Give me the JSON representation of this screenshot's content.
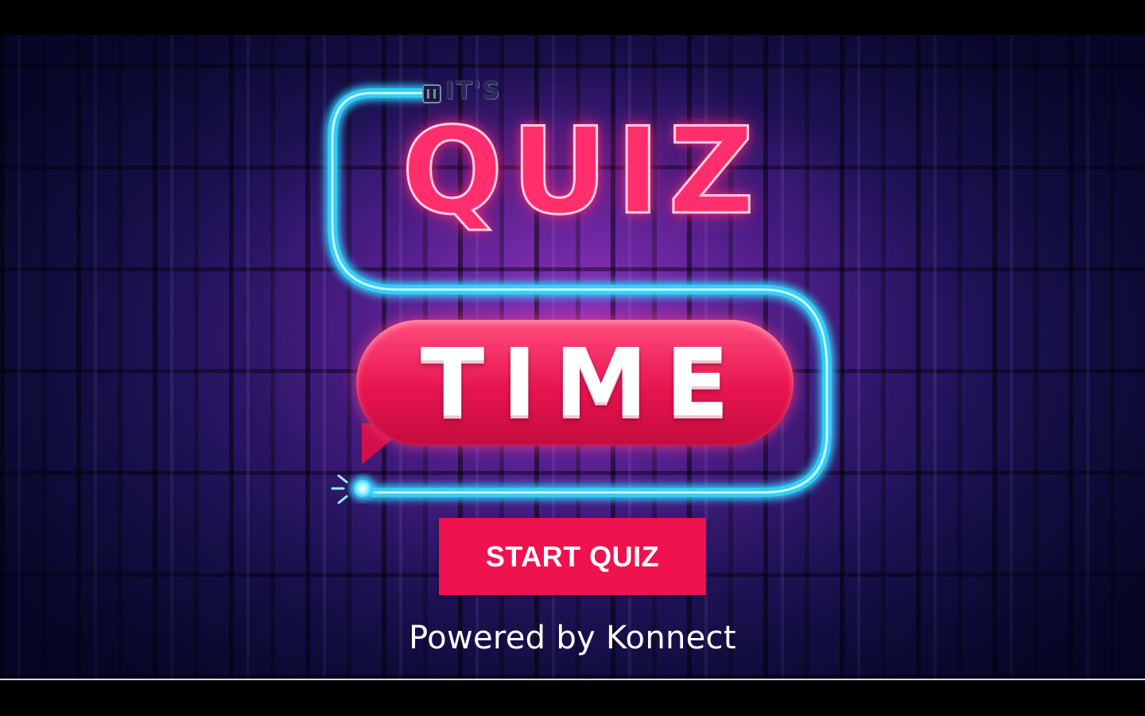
{
  "logo": {
    "prefix": "IT'S",
    "line1": "QUIZ",
    "line2": "TIME"
  },
  "actions": {
    "start_label": "START QUIZ"
  },
  "footer": {
    "powered_by": "Powered by Konnect"
  },
  "colors": {
    "button_red": "#f0114f",
    "neon_cyan": "#35d6ff",
    "neon_pink": "#ff2f6e",
    "background_purple": "#6a2fb0"
  },
  "icons": [
    "plug-icon",
    "light-bulb-icon"
  ]
}
